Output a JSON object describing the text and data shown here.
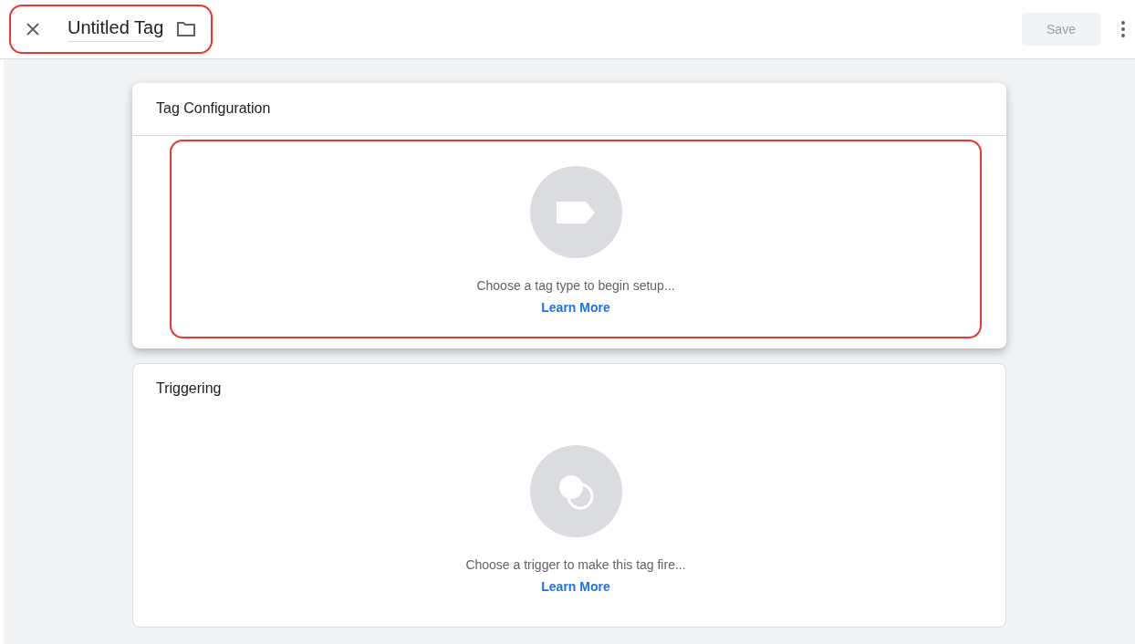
{
  "header": {
    "title": "Untitled Tag",
    "highlighted": true,
    "save": {
      "label": "Save",
      "disabled": true
    }
  },
  "cards": [
    {
      "kind": "tag",
      "title": "Tag Configuration",
      "elevated": true,
      "highlighted": true,
      "message": "Choose a tag type to begin setup...",
      "link": "Learn More"
    },
    {
      "kind": "trigger",
      "title": "Triggering",
      "elevated": false,
      "highlighted": false,
      "message": "Choose a trigger to make this tag fire...",
      "link": "Learn More"
    }
  ]
}
